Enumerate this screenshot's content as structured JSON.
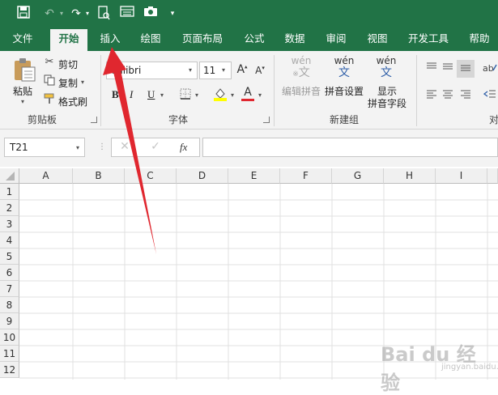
{
  "colors": {
    "accent": "#217346",
    "arrow": "#e0272f"
  },
  "quick_access": {
    "icons": [
      "save-icon",
      "undo-icon",
      "redo-icon",
      "print-preview-icon",
      "form-icon",
      "camera-icon",
      "customize-icon"
    ]
  },
  "tabs": [
    "文件",
    "开始",
    "插入",
    "绘图",
    "页面布局",
    "公式",
    "数据",
    "审阅",
    "视图",
    "开发工具",
    "帮助"
  ],
  "active_tab": "开始",
  "ribbon": {
    "clipboard": {
      "paste": "粘贴",
      "cut": "剪切",
      "copy": "复制",
      "format_painter": "格式刷",
      "group": "剪贴板"
    },
    "font": {
      "font_name": "Calibri",
      "font_size": "11",
      "bold": "B",
      "italic": "I",
      "underline": "U",
      "font_color_letter": "A",
      "group": "字体"
    },
    "phonetic": {
      "edit_pinyin": "编辑拼音",
      "pinyin_settings": "拼音设置",
      "show_line1": "显示",
      "show_line2": "拼音字段",
      "wen": "wén",
      "wen_char": "文",
      "group": "新建组"
    },
    "alignment": {
      "group_partial": "对"
    }
  },
  "formula_bar": {
    "name_box": "T21",
    "fx": "fx",
    "formula": ""
  },
  "sheet": {
    "columns": [
      "A",
      "B",
      "C",
      "D",
      "E",
      "F",
      "G",
      "H",
      "I"
    ],
    "rows": [
      "1",
      "2",
      "3",
      "4",
      "5",
      "6",
      "7",
      "8",
      "9",
      "10",
      "11",
      "12"
    ]
  },
  "watermark": {
    "brand": "Bai du 经验",
    "url": "jingyan.baidu.com"
  }
}
